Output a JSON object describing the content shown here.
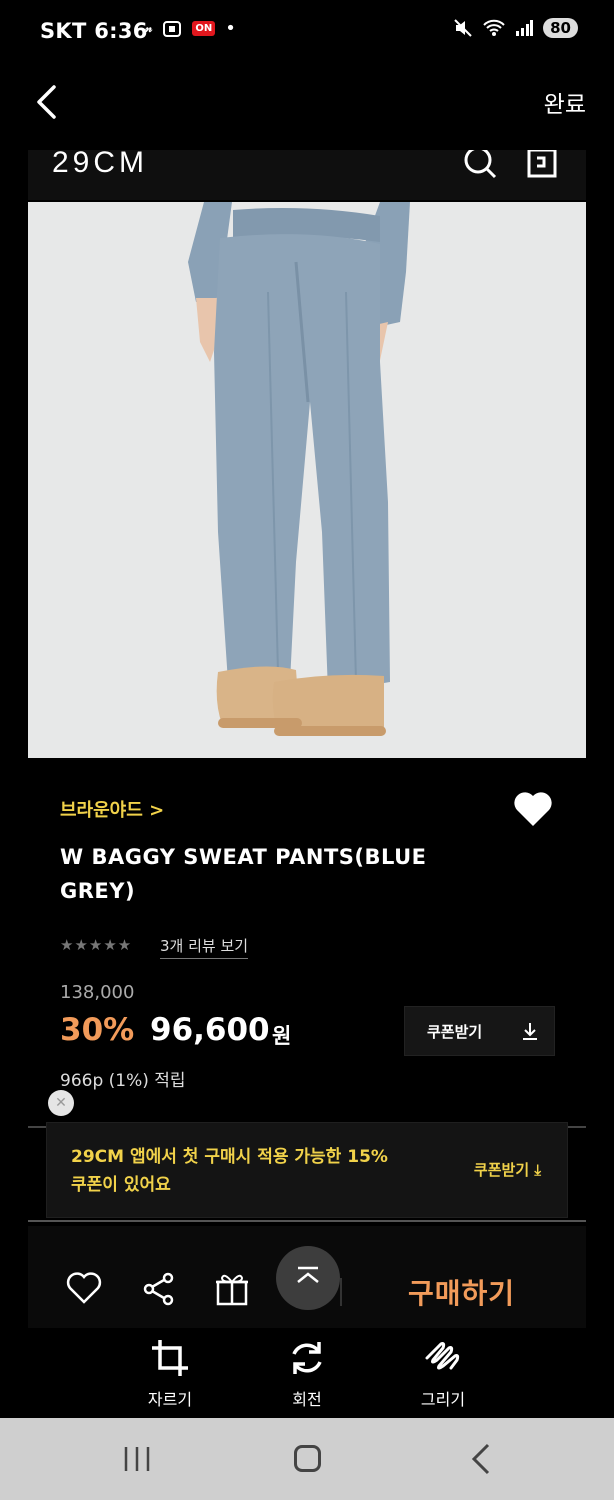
{
  "status_bar": {
    "carrier": "SKT 6:36",
    "icon_left_1": "netflix-glyph",
    "on_badge": "ON",
    "battery": "80"
  },
  "editor": {
    "done_label": "완료",
    "tools": [
      {
        "label": "자르기",
        "icon": "crop-icon"
      },
      {
        "label": "회전",
        "icon": "rotate-icon"
      },
      {
        "label": "그리기",
        "icon": "draw-icon"
      }
    ]
  },
  "header": {
    "logo": "29CM"
  },
  "product": {
    "brand": "브라운야드 >",
    "title": "W BAGGY SWEAT PANTS(BLUE GREY)",
    "stars": "★★★★★",
    "rating": 5,
    "reviews_link": "3개 리뷰 보기",
    "original_price": "138,000",
    "discount": "30%",
    "price": "96,600",
    "currency": "원",
    "coupon_button": "쿠폰받기",
    "points": "966p (1%) 적립"
  },
  "promo": {
    "text": "29CM 앱에서 첫 구매시 적용 가능한 15% 쿠폰이 있어요",
    "button": "쿠폰받기"
  },
  "bottom_bar": {
    "buy_label": "구매하기"
  },
  "colors": {
    "accent_yellow": "#f1d24a",
    "accent_orange": "#f29b5a",
    "photo_bg": "#e7e8e8"
  }
}
